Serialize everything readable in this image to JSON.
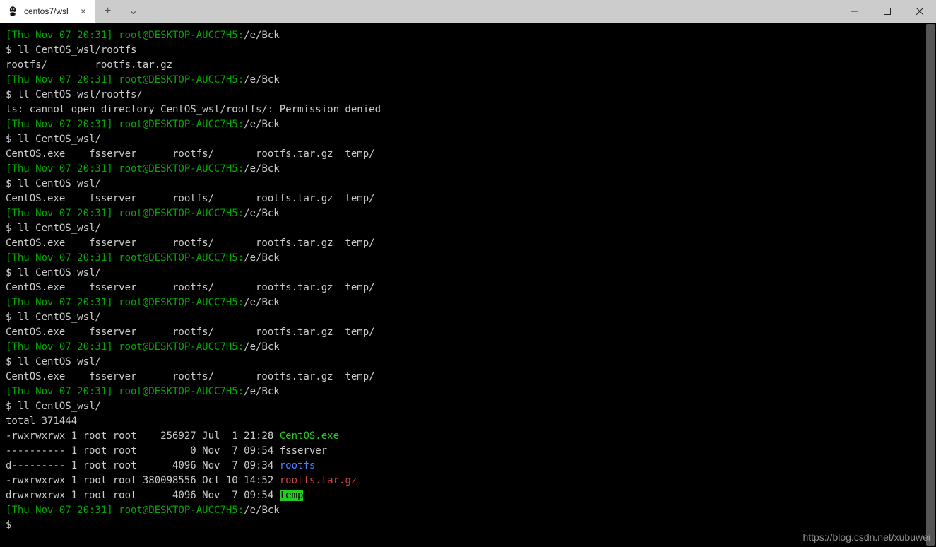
{
  "tab": {
    "title": "centos7/wsl",
    "close_glyph": "×"
  },
  "new_tab_glyph": "+",
  "dropdown_glyph": "⌄",
  "watermark": "https://blog.csdn.net/xubuwei",
  "prompt": {
    "ts": "[Thu Nov 07 20:31]",
    "userhost": " root@DESKTOP-AUCC7H5:",
    "cwd": "/e/Bck",
    "ps_glyph": "$ "
  },
  "lines": [
    {
      "type": "prompt"
    },
    {
      "type": "cmd",
      "text": "ll CentOS_wsl/rootfs"
    },
    {
      "type": "out",
      "segments": [
        {
          "t": "rootfs/        rootfs.tar.gz"
        }
      ]
    },
    {
      "type": "prompt"
    },
    {
      "type": "cmd",
      "text": "ll CentOS_wsl/rootfs/"
    },
    {
      "type": "out",
      "segments": [
        {
          "t": "ls: cannot open directory CentOS_wsl/rootfs/: Permission denied"
        }
      ]
    },
    {
      "type": "prompt"
    },
    {
      "type": "cmd",
      "text": "ll CentOS_wsl/"
    },
    {
      "type": "out",
      "segments": [
        {
          "t": "CentOS.exe    fsserver      rootfs/       rootfs.tar.gz  temp/"
        }
      ]
    },
    {
      "type": "prompt"
    },
    {
      "type": "cmd",
      "text": "ll CentOS_wsl/"
    },
    {
      "type": "out",
      "segments": [
        {
          "t": "CentOS.exe    fsserver      rootfs/       rootfs.tar.gz  temp/"
        }
      ]
    },
    {
      "type": "prompt"
    },
    {
      "type": "cmd",
      "text": "ll CentOS_wsl/"
    },
    {
      "type": "out",
      "segments": [
        {
          "t": "CentOS.exe    fsserver      rootfs/       rootfs.tar.gz  temp/"
        }
      ]
    },
    {
      "type": "prompt"
    },
    {
      "type": "cmd",
      "text": "ll CentOS_wsl/"
    },
    {
      "type": "out",
      "segments": [
        {
          "t": "CentOS.exe    fsserver      rootfs/       rootfs.tar.gz  temp/"
        }
      ]
    },
    {
      "type": "prompt"
    },
    {
      "type": "cmd",
      "text": "ll CentOS_wsl/"
    },
    {
      "type": "out",
      "segments": [
        {
          "t": "CentOS.exe    fsserver      rootfs/       rootfs.tar.gz  temp/"
        }
      ]
    },
    {
      "type": "prompt"
    },
    {
      "type": "cmd",
      "text": "ll CentOS_wsl/"
    },
    {
      "type": "out",
      "segments": [
        {
          "t": "CentOS.exe    fsserver      rootfs/       rootfs.tar.gz  temp/"
        }
      ]
    },
    {
      "type": "prompt"
    },
    {
      "type": "cmd",
      "text": "ll CentOS_wsl/"
    },
    {
      "type": "out",
      "segments": [
        {
          "t": "total 371444"
        }
      ]
    },
    {
      "type": "out",
      "segments": [
        {
          "t": "-rwxrwxrwx 1 root root    256927 Jul  1 21:28 "
        },
        {
          "t": "CentOS.exe",
          "cls": "c-exe"
        }
      ]
    },
    {
      "type": "out",
      "segments": [
        {
          "t": "---------- 1 root root         0 Nov  7 09:54 fsserver"
        }
      ]
    },
    {
      "type": "out",
      "segments": [
        {
          "t": "d--------- 1 root root      4096 Nov  7 09:34 "
        },
        {
          "t": "rootfs",
          "cls": "c-dir"
        }
      ]
    },
    {
      "type": "out",
      "segments": [
        {
          "t": "-rwxrwxrwx 1 root root 380098556 Oct 10 14:52 "
        },
        {
          "t": "rootfs.tar.gz",
          "cls": "c-red"
        }
      ]
    },
    {
      "type": "out",
      "segments": [
        {
          "t": "drwxrwxrwx 1 root root      4096 Nov  7 09:54 "
        },
        {
          "t": "temp",
          "cls": "c-hl"
        }
      ]
    },
    {
      "type": "prompt"
    },
    {
      "type": "cmd",
      "text": ""
    }
  ]
}
